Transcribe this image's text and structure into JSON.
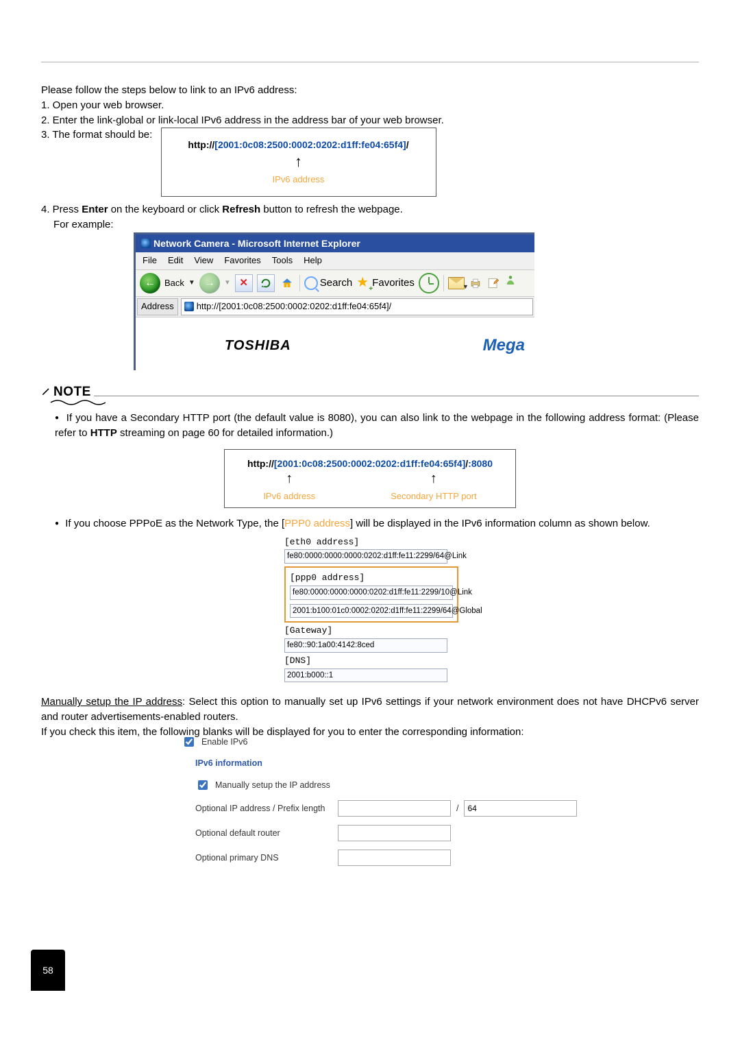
{
  "top": {
    "intro": "Please follow the steps below to link to an IPv6 address:",
    "step1": "1. Open your web browser.",
    "step2": "2. Enter the link-global or link-local IPv6 address in the address bar of your web browser.",
    "step3": "3. The format should be:"
  },
  "urlbox1": {
    "prefix": "http://",
    "bracket_open": "[",
    "addr": "2001:0c08:2500:0002:0202:d1ff:fe04:65f4",
    "bracket_close": "]",
    "suffix": "/",
    "label": "IPv6 address"
  },
  "step4a": "4. Press ",
  "step4b": "Enter",
  "step4c": " on the keyboard or click ",
  "step4d": "Refresh",
  "step4e": " button to refresh the webpage.",
  "step4f": "For example:",
  "ie": {
    "title": "Network Camera - Microsoft Internet Explorer",
    "menu": [
      "File",
      "Edit",
      "View",
      "Favorites",
      "Tools",
      "Help"
    ],
    "back": "Back",
    "search": "Search",
    "favorites": "Favorites",
    "address_label": "Address",
    "address_value": "http://[2001:0c08:2500:0002:0202:d1ff:fe04:65f4]/",
    "body_toshiba": "TOSHIBA",
    "body_mega": "Mega"
  },
  "note": "NOTE",
  "bullet1a": "If you have a Secondary HTTP port (the default value is 8080), you can also link to the webpage in the following address format: (Please refer to ",
  "bullet1b": "HTTP",
  "bullet1c": " streaming on page 60 for detailed information.)",
  "urlbox2": {
    "prefix": "http://",
    "bracket_open": "[",
    "addr": "2001:0c08:2500:0002:0202:d1ff:fe04:65f4",
    "bracket_close": "]",
    "suffix1": "/",
    "suffix2": ":8080",
    "lbl1": "IPv6 address",
    "lbl2": "Secondary HTTP port"
  },
  "bullet2a": "If you choose PPPoE as the Network Type, the [",
  "bullet2b": "PPP0 address",
  "bullet2c": "] will be displayed in the IPv6 information column as shown below.",
  "ipv6info": {
    "eth0_label": "[eth0 address]",
    "eth0_val": "fe80:0000:0000:0000:0202:d1ff:fe11:2299/64@Link",
    "ppp0_label": "[ppp0 address]",
    "ppp0_val1": "fe80:0000:0000:0000:0202:d1ff:fe11:2299/10@Link",
    "ppp0_val2": "2001:b100:01c0:0002:0202:d1ff:fe11:2299/64@Global",
    "gw_label": "[Gateway]",
    "gw_val": "fe80::90:1a00:4142:8ced",
    "dns_label": "[DNS]",
    "dns_val": "2001:b000::1"
  },
  "manual1a": "Manually setup the IP address",
  "manual1b": ": Select this option to manually set up IPv6 settings if your network environment does not have DHCPv6 server and router advertisements-enabled routers.",
  "manual2": "If you check this item, the following blanks will be displayed for you to enter the corresponding information:",
  "settings": {
    "enable": "Enable IPv6",
    "hdr": "IPv6 information",
    "manual": "Manually setup the IP address",
    "ipprefix": "Optional IP address / Prefix length",
    "prefix_val": "64",
    "router": "Optional default router",
    "dns": "Optional primary DNS"
  },
  "page_number": "58"
}
